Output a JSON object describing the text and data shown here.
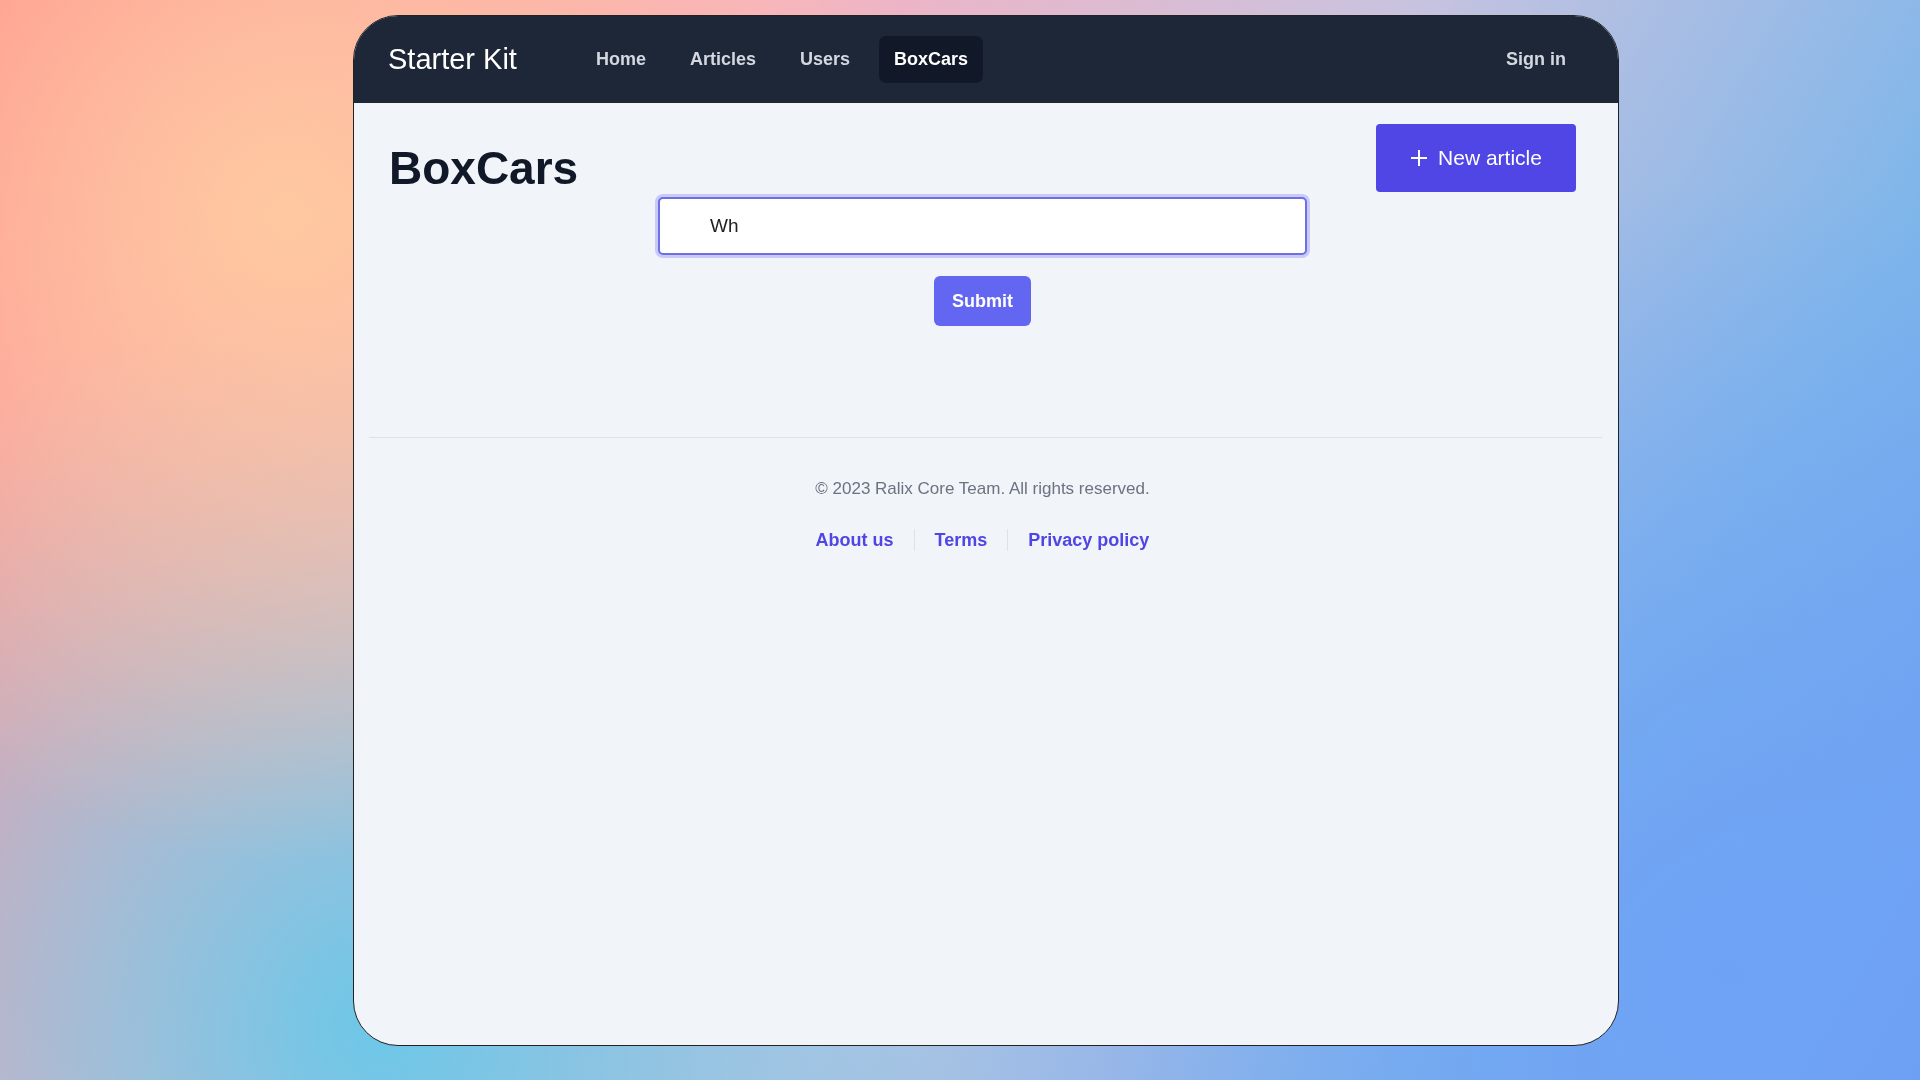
{
  "navbar": {
    "brand": "Starter Kit",
    "links": [
      {
        "label": "Home",
        "selected": false
      },
      {
        "label": "Articles",
        "selected": false
      },
      {
        "label": "Users",
        "selected": false
      },
      {
        "label": "BoxCars",
        "selected": true
      }
    ],
    "sign_in": "Sign in"
  },
  "page": {
    "title": "BoxCars",
    "new_button": "New article"
  },
  "form": {
    "value": "Wh",
    "submit": "Submit"
  },
  "footer": {
    "copyright": "© 2023 Ralix Core Team. All rights reserved.",
    "links": [
      "About us",
      "Terms",
      "Privacy policy"
    ]
  }
}
